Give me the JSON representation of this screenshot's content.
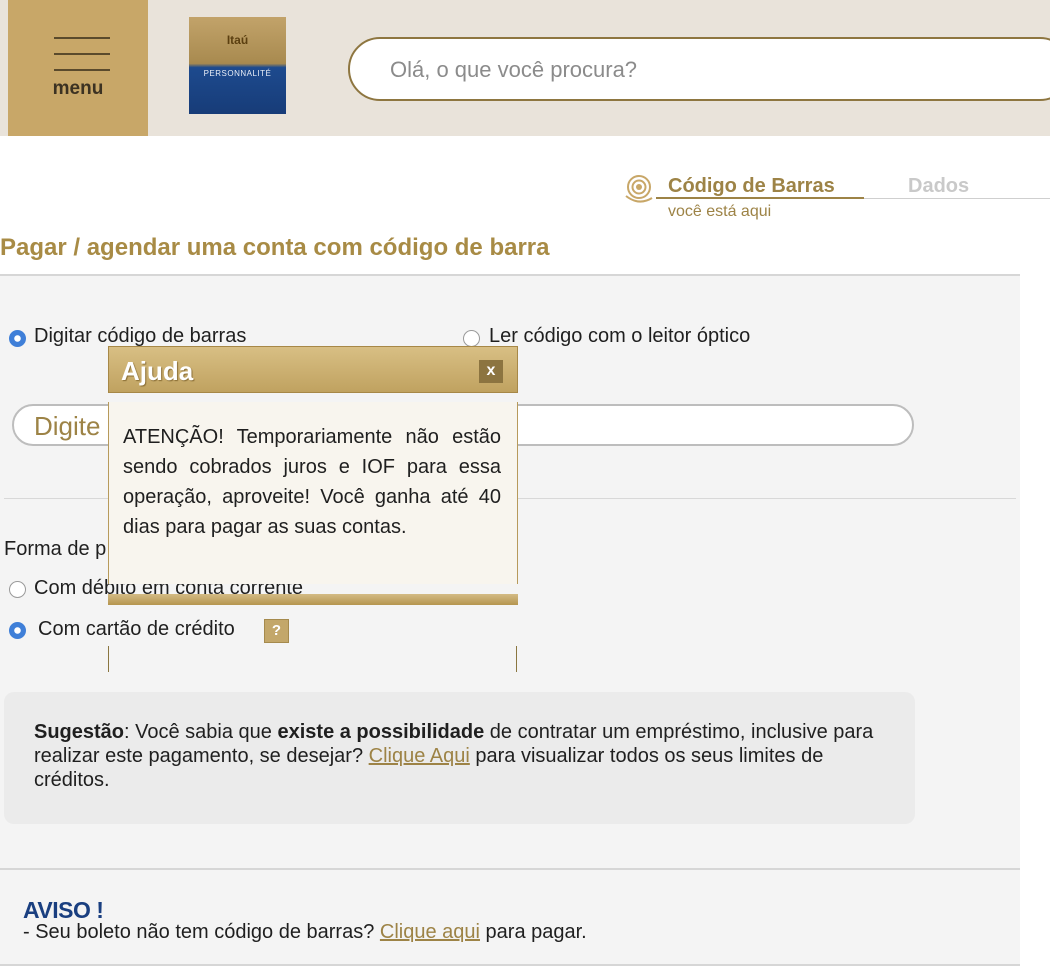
{
  "header": {
    "menu_label": "menu",
    "logo_top": "Itaú",
    "logo_bottom": "PERSONNALITÉ",
    "search_placeholder": "Olá, o que você procura?"
  },
  "steps": {
    "step1_label": "Código de Barras",
    "step1_sub": "você está aqui",
    "step2_label": "Dados"
  },
  "page": {
    "title": "Pagar / agendar uma conta com código de barra"
  },
  "entry_options": {
    "type_barcode": "Digitar código de barras",
    "scan_barcode": "Ler código com o leitor óptico",
    "selected": "type_barcode"
  },
  "barcode_input": {
    "visible_text": "Digite"
  },
  "payment": {
    "label_visible": "Forma de p",
    "debit": "Com débito em conta corrente",
    "credit": "Com cartão de crédito",
    "selected": "credit",
    "help_icon": "?"
  },
  "suggestion": {
    "bold1": "Sugestão",
    "text1": ": Você sabia que ",
    "bold2": "existe a possibilidade",
    "text2": " de contratar um empréstimo, inclusive para realizar este pagamento, se desejar? ",
    "link": "Clique Aqui",
    "text3": " para visualizar todos os seus limites de créditos."
  },
  "notice": {
    "title": "AVISO !",
    "text1": "- Seu boleto não tem código de barras? ",
    "link": "Clique aqui",
    "text2": " para pagar."
  },
  "popup": {
    "title": "Ajuda",
    "close": "x",
    "message": "ATENÇÃO! Temporariamente não estão sendo cobrados juros e IOF para essa operação, aproveite! Você ganha até 40 dias para pagar as suas contas."
  },
  "icons": {
    "menu": "hamburger-icon",
    "step_current": "target-icon",
    "help": "question-icon",
    "close": "close-icon"
  },
  "colors": {
    "gold": "#c8a768",
    "gold_text": "#9d8346",
    "header_bg": "#e9e3da",
    "radio_selected": "#3f7fd8",
    "aviso_blue": "#1a3f80"
  }
}
